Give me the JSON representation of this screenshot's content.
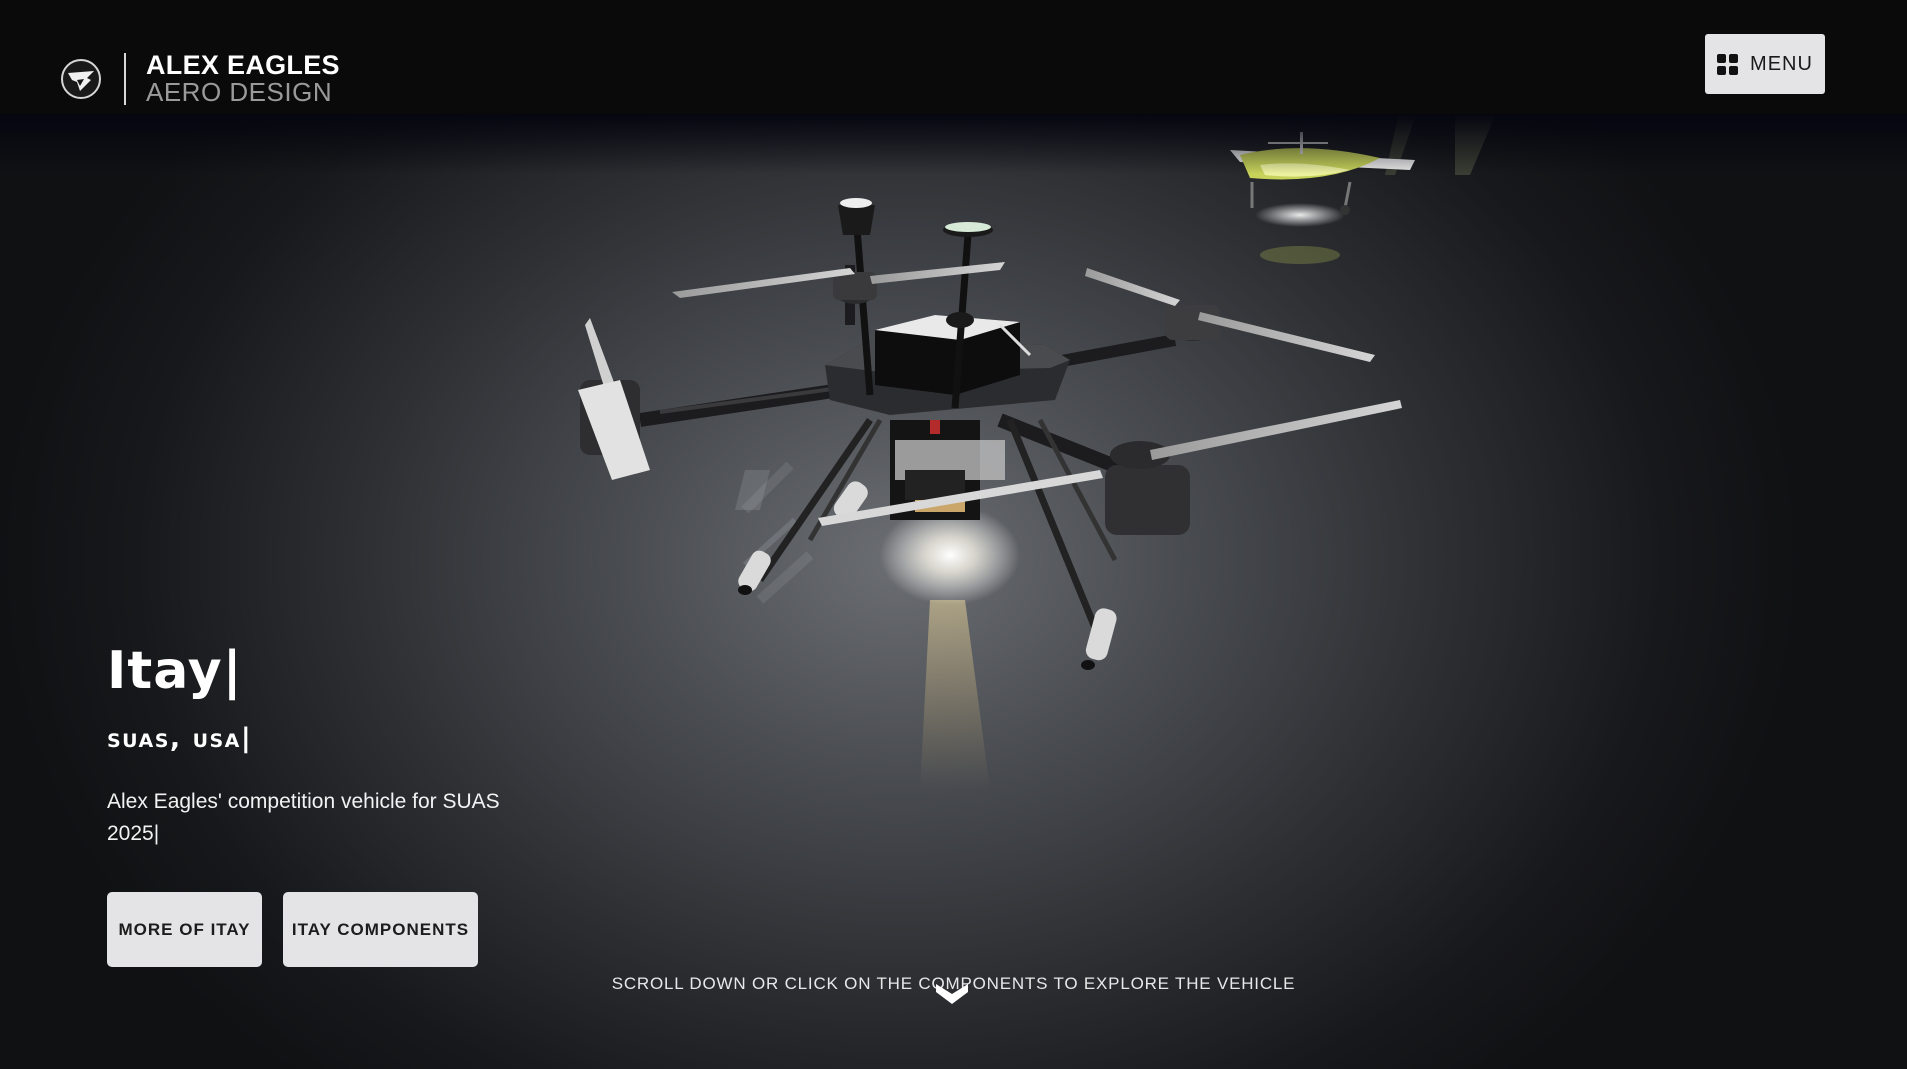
{
  "header": {
    "brand_name": "ALEX EAGLES",
    "brand_sub": "AERO DESIGN",
    "menu_label": "MENU"
  },
  "hero": {
    "title": "Itay|",
    "subtitle": "SUAS, USA|",
    "description": "Alex Eagles' competition vehicle for SUAS 2025|",
    "buttons": {
      "more": "MORE OF ITAY",
      "components": "ITAY COMPONENTS"
    }
  },
  "scroll_hint": "SCROLL DOWN OR CLICK ON THE COMPONENTS TO EXPLORE THE VEHICLE",
  "colors": {
    "header_bg": "#0a0a0a",
    "button_bg": "#e4e4e6",
    "accent_plane": "#c6d25a"
  },
  "icons": {
    "logo": "eagle-logo-icon",
    "menu": "grid-menu-icon",
    "scroll": "chevron-down-icon"
  }
}
